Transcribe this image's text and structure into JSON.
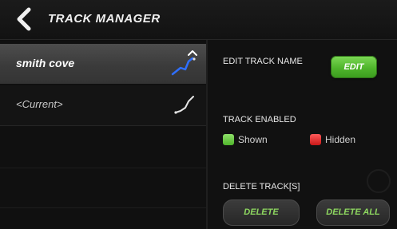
{
  "header": {
    "title": "TRACK MANAGER"
  },
  "tracks": [
    {
      "name": "smith cove",
      "selected": true
    },
    {
      "name": "<Current>",
      "selected": false
    }
  ],
  "panel": {
    "edit_track_label": "EDIT TRACK NAME",
    "edit_button_label": "EDIT",
    "track_enabled_label": "TRACK ENABLED",
    "shown_label": "Shown",
    "hidden_label": "Hidden",
    "delete_tracks_label": "DELETE TRACK[S]",
    "delete_button_label": "DELETE",
    "delete_all_button_label": "DELETE ALL"
  },
  "colors": {
    "accent_green": "#4fb52b",
    "hidden_red": "#c81818",
    "track_line_blue": "#2f6fff"
  },
  "icons": {
    "back": "chevron-left-icon",
    "track_preview": "track-line-icon"
  }
}
